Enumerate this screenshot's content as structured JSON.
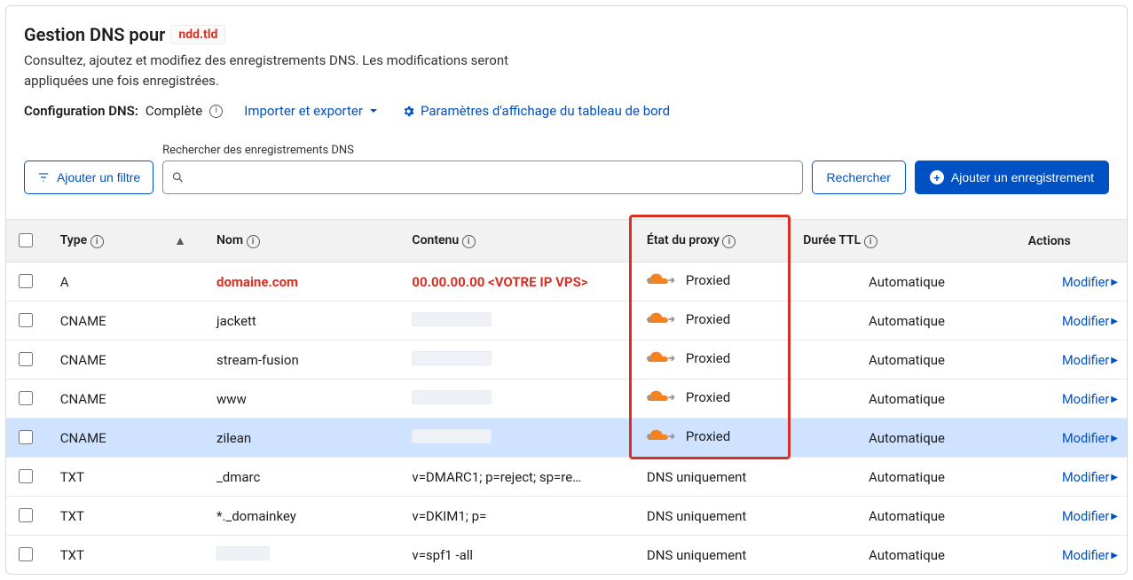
{
  "header": {
    "title_prefix": "Gestion DNS pour",
    "domain_chip": "ndd.tld",
    "subtitle": "Consultez, ajoutez et modifiez des enregistrements DNS. Les modifications seront appliquées une fois enregistrées.",
    "config_label": "Configuration DNS:",
    "config_value": "Complète",
    "import_export": "Importer et exporter",
    "dashboard_settings": "Paramètres d'affichage du tableau de bord"
  },
  "toolbar": {
    "add_filter": "Ajouter un filtre",
    "search_label": "Rechercher des enregistrements DNS",
    "search_placeholder": "",
    "search_button": "Rechercher",
    "add_record": "Ajouter un enregistrement"
  },
  "columns": {
    "type": "Type",
    "name": "Nom",
    "content": "Contenu",
    "proxy": "État du proxy",
    "ttl": "Durée TTL",
    "actions": "Actions"
  },
  "proxy_states": {
    "proxied": "Proxied",
    "dns_only": "DNS uniquement"
  },
  "ttl_auto": "Automatique",
  "modify_label": "Modifier",
  "records": [
    {
      "type": "A",
      "name": "domaine.com",
      "name_style": "red",
      "content": "00.00.00.00 <VOTRE IP VPS>",
      "content_style": "red",
      "proxy": "proxied",
      "ttl": "Automatique",
      "highlight": false
    },
    {
      "type": "CNAME",
      "name": "jackett",
      "name_style": "normal",
      "content": "",
      "content_style": "blur",
      "proxy": "proxied",
      "ttl": "Automatique",
      "highlight": false
    },
    {
      "type": "CNAME",
      "name": "stream-fusion",
      "name_style": "normal",
      "content": "",
      "content_style": "blur",
      "proxy": "proxied",
      "ttl": "Automatique",
      "highlight": false
    },
    {
      "type": "CNAME",
      "name": "www",
      "name_style": "normal",
      "content": "",
      "content_style": "blur",
      "proxy": "proxied",
      "ttl": "Automatique",
      "highlight": false
    },
    {
      "type": "CNAME",
      "name": "zilean",
      "name_style": "normal",
      "content": "",
      "content_style": "blur",
      "proxy": "proxied",
      "ttl": "Automatique",
      "highlight": true
    },
    {
      "type": "TXT",
      "name": "_dmarc",
      "name_style": "normal",
      "content": "v=DMARC1; p=reject; sp=re…",
      "content_style": "normal",
      "proxy": "dns_only",
      "ttl": "Automatique",
      "highlight": false
    },
    {
      "type": "TXT",
      "name": "*._domainkey",
      "name_style": "normal",
      "content": "v=DKIM1; p=",
      "content_style": "normal",
      "proxy": "dns_only",
      "ttl": "Automatique",
      "highlight": false
    },
    {
      "type": "TXT",
      "name": "",
      "name_style": "blur",
      "content": "v=spf1 -all",
      "content_style": "normal",
      "proxy": "dns_only",
      "ttl": "Automatique",
      "highlight": false
    }
  ]
}
